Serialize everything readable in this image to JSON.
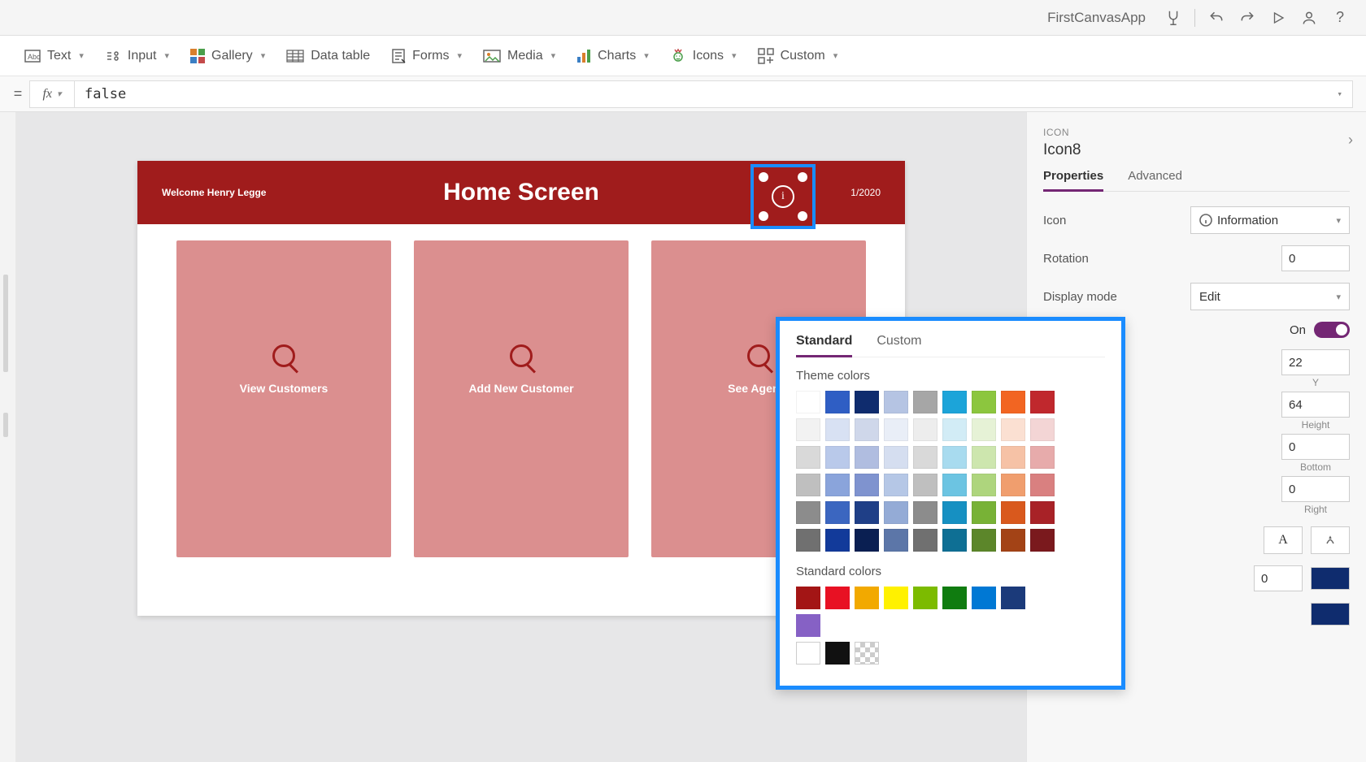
{
  "titlebar": {
    "app_name": "FirstCanvasApp"
  },
  "insert": {
    "text": "Text",
    "input": "Input",
    "gallery": "Gallery",
    "datatable": "Data table",
    "forms": "Forms",
    "media": "Media",
    "charts": "Charts",
    "icons": "Icons",
    "custom": "Custom"
  },
  "formula": {
    "value": "false"
  },
  "canvas": {
    "welcome": "Welcome Henry Legge",
    "title": "Home Screen",
    "date": "1/2020",
    "cards": [
      "View Customers",
      "Add New Customer",
      "See Agents"
    ]
  },
  "panel": {
    "category": "ICON",
    "name": "Icon8",
    "tabs": {
      "properties": "Properties",
      "advanced": "Advanced"
    },
    "props": {
      "icon_label": "Icon",
      "icon_value": "Information",
      "rotation_label": "Rotation",
      "rotation_value": "0",
      "display_label": "Display mode",
      "display_value": "Edit",
      "on_label": "On",
      "y_value": "22",
      "y_caption": "Y",
      "height_value": "64",
      "height_caption": "Height",
      "pad_bottom_value": "0",
      "pad_bottom_caption": "Bottom",
      "pad_right_value": "0",
      "pad_right_caption": "Right",
      "border_value": "0",
      "font_letter": "A",
      "swatch1": "#0f2c6e",
      "swatch2": "#0f2c6e"
    }
  },
  "picker": {
    "tabs": {
      "standard": "Standard",
      "custom": "Custom"
    },
    "theme_label": "Theme colors",
    "standard_label": "Standard colors",
    "theme_rows": [
      [
        "#ffffff",
        "#2f5ec4",
        "#0f2c6e",
        "#b5c4e3",
        "#a6a6a6",
        "#1ca4d9",
        "#8cc63e",
        "#f26522",
        "#c0282d"
      ],
      [
        "#f2f2f2",
        "#d8e1f3",
        "#cfd7ea",
        "#e9eef7",
        "#ededed",
        "#d2ecf6",
        "#e6f2d6",
        "#fbe0d2",
        "#f3d5d5"
      ],
      [
        "#d9d9d9",
        "#b9c9ea",
        "#b0bde0",
        "#d5def0",
        "#d9d9d9",
        "#a8dbef",
        "#cde6ae",
        "#f6c2a6",
        "#e7abab"
      ],
      [
        "#bfbfbf",
        "#8aa4db",
        "#7f93cf",
        "#b5c7e6",
        "#bfbfbf",
        "#6cc4e2",
        "#aed57d",
        "#f09e6e",
        "#d98080"
      ],
      [
        "#8c8c8c",
        "#3b66c0",
        "#1f3f87",
        "#94abd6",
        "#8c8c8c",
        "#1690c2",
        "#78b236",
        "#d9591d",
        "#a82227"
      ],
      [
        "#707070",
        "#123a9a",
        "#0a1f52",
        "#5c76a8",
        "#707070",
        "#0e6f94",
        "#5c862a",
        "#a34316",
        "#7a191d"
      ]
    ],
    "standard_row1": [
      "#a31515",
      "#e81123",
      "#f2a900",
      "#fff100",
      "#7cbb00",
      "#107c10",
      "#0078d4",
      "#1b3a7a",
      "#8661c5"
    ],
    "standard_row2": [
      "#ffffff",
      "#111111",
      "checker"
    ]
  }
}
